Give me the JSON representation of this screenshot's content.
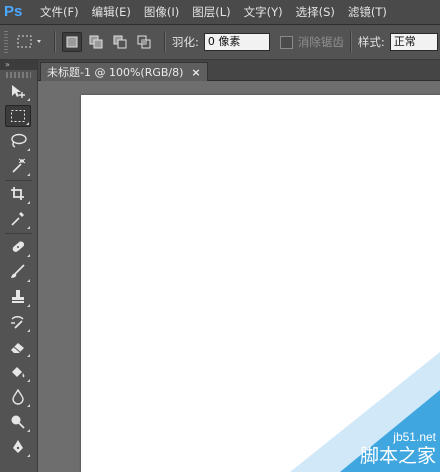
{
  "app": {
    "logo": "Ps"
  },
  "menu": [
    "文件(F)",
    "编辑(E)",
    "图像(I)",
    "图层(L)",
    "文字(Y)",
    "选择(S)",
    "滤镜(T)"
  ],
  "options": {
    "feather_label": "羽化:",
    "feather_value": "0 像素",
    "antialias_label": "消除锯齿",
    "style_label": "样式:",
    "style_value": "正常"
  },
  "toolbox": {
    "header": "»"
  },
  "document": {
    "tab_title": "未标题-1 @ 100%(RGB/8)",
    "close": "×"
  },
  "watermark": {
    "url": "jb51.net",
    "name": "脚本之家"
  },
  "colors": {
    "accent": "#4aa8ff",
    "panel": "#535353",
    "canvas": "#ffffff",
    "watermark": "#3fa6e0"
  }
}
